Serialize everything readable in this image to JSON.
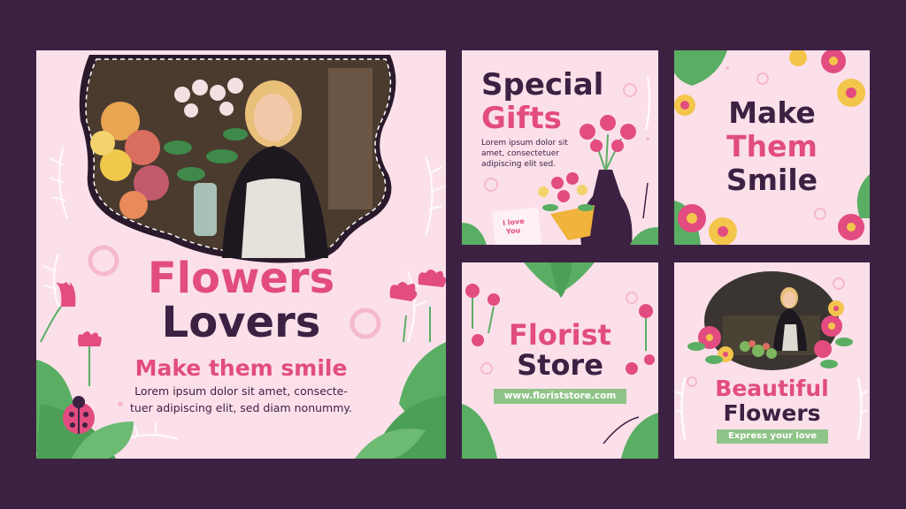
{
  "colors": {
    "background": "#3d2143",
    "card": "#fbe0ea",
    "pink": "#e24c80",
    "plum": "#3d2143",
    "leaf": "#5aae63",
    "tag": "#8fc488"
  },
  "post_main": {
    "title_line1": "Flowers",
    "title_line2": "Lovers",
    "subtitle": "Make them smile",
    "body_line1": "Lorem ipsum dolor sit amet, consecte-",
    "body_line2": "tuer adipiscing elit, sed diam nonummy.",
    "photo": "florist-woman-holding-roses-photo"
  },
  "post_gifts": {
    "title_line1": "Special",
    "title_line2": "Gifts",
    "body_line1": "Lorem ipsum dolor sit",
    "body_line2": "amet, consectetuer",
    "body_line3": "adipiscing elit sed.",
    "card_line1": "I love",
    "card_line2": "You"
  },
  "post_smile": {
    "line1": "Make",
    "line2": "Them",
    "line3": "Smile"
  },
  "post_store": {
    "title_line1": "Florist",
    "title_line2": "Store",
    "url": "www.floriststore.com"
  },
  "post_beautiful": {
    "title_line1": "Beautiful",
    "title_line2": "Flowers",
    "tagline": "Express your love",
    "photo": "florist-woman-arranging-flowers-photo"
  }
}
